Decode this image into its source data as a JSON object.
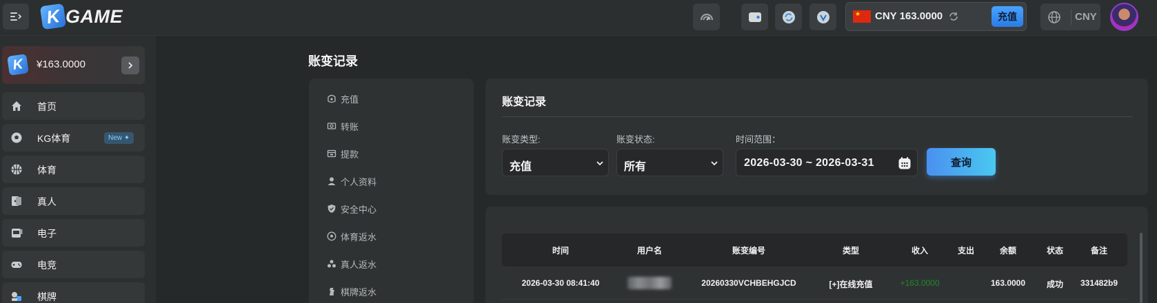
{
  "header": {
    "logo_text": "GAME",
    "logo_letter": "K",
    "balance": "CNY 163.0000",
    "deposit_label": "充值",
    "language": "CNY"
  },
  "sidebar": {
    "wallet_amount": "¥163.0000",
    "wallet_letter": "K",
    "items": [
      {
        "label": "首页",
        "icon": "home-icon"
      },
      {
        "label": "KG体育",
        "icon": "soccer-ball-icon",
        "badge": "New ✦"
      },
      {
        "label": "体育",
        "icon": "basketball-icon"
      },
      {
        "label": "真人",
        "icon": "cards-icon"
      },
      {
        "label": "电子",
        "icon": "slot-machine-icon"
      },
      {
        "label": "电竞",
        "icon": "gamepad-icon"
      },
      {
        "label": "棋牌",
        "icon": "chess-icon"
      }
    ]
  },
  "page": {
    "title": "账变记录"
  },
  "submenu": {
    "items": [
      {
        "label": "充值",
        "icon": "deposit-icon"
      },
      {
        "label": "转账",
        "icon": "transfer-icon"
      },
      {
        "label": "提款",
        "icon": "withdraw-icon"
      },
      {
        "label": "个人资料",
        "icon": "profile-icon"
      },
      {
        "label": "安全中心",
        "icon": "shield-icon"
      },
      {
        "label": "体育返水",
        "icon": "soccer-ball-icon"
      },
      {
        "label": "真人返水",
        "icon": "live-rebate-icon"
      },
      {
        "label": "棋牌返水",
        "icon": "chess-icon"
      }
    ]
  },
  "filter": {
    "title": "账变记录",
    "type_label": "账变类型:",
    "type_value": "充值",
    "status_label": "账变状态:",
    "status_value": "所有",
    "range_label": "时间范围：",
    "range_value": "2026-03-30 ~ 2026-03-31",
    "query_label": "查询"
  },
  "table": {
    "headers": [
      "时间",
      "用户名",
      "账变编号",
      "类型",
      "收入",
      "支出",
      "余额",
      "状态",
      "备注"
    ],
    "rows": [
      {
        "time": "2026-03-30 08:41:40",
        "username": "",
        "id": "20260330VCHBEHGJCD",
        "type": "[+]在线充值",
        "income": "+163.0000",
        "expense": "",
        "balance": "163.0000",
        "status": "成功",
        "note": "331482b9"
      }
    ]
  },
  "colors": {
    "background": "#26292a",
    "panel": "#2f3233",
    "accent": "#4a90f0",
    "income_green": "#1f8a2b"
  }
}
